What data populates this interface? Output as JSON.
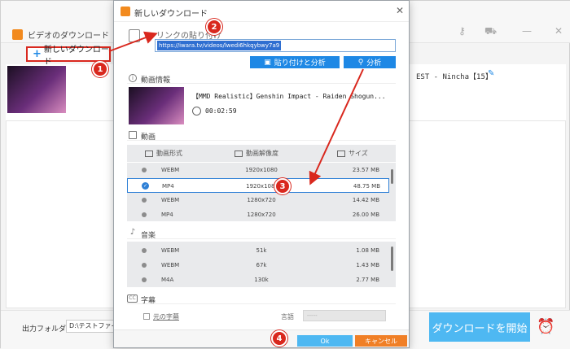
{
  "app": {
    "title": "ビデオのダウンロード",
    "new_download_label": "新しいダウンロード",
    "item_title": "EST - Nincha【15】",
    "output_folder_label": "出力フォルダ：",
    "output_folder_value": "D:\\テストファイル",
    "start_download_label": "ダウンロードを開始"
  },
  "dialog": {
    "title": "新しいダウンロード",
    "paste_link_label": "リンクの貼り付け",
    "url_value": "https://iwara.tv/videos/lwedi6hkqybwy7a9",
    "paste_analyze_label": "貼り付けと分析",
    "analyze_label": "分析",
    "video_info_label": "動画情報",
    "video_title": "【MMD Realistic】Genshin Impact - Raiden Shogun...",
    "duration": "00:02:59",
    "video_section_label": "動画",
    "video_headers": [
      "動画形式",
      "動画解像度",
      "サイズ"
    ],
    "video_rows": [
      {
        "format": "WEBM",
        "res": "1920x1080",
        "size": "23.57 MB",
        "selected": false
      },
      {
        "format": "MP4",
        "res": "1920x1080",
        "size": "48.75 MB",
        "selected": true
      },
      {
        "format": "WEBM",
        "res": "1280x720",
        "size": "14.42 MB",
        "selected": false
      },
      {
        "format": "MP4",
        "res": "1280x720",
        "size": "26.00 MB",
        "selected": false
      }
    ],
    "audio_section_label": "音楽",
    "audio_rows": [
      {
        "format": "WEBM",
        "bitrate": "51k",
        "size": "1.08 MB"
      },
      {
        "format": "WEBM",
        "bitrate": "67k",
        "size": "1.43 MB"
      },
      {
        "format": "M4A",
        "bitrate": "130k",
        "size": "2.77 MB"
      }
    ],
    "subtitle_section_label": "字幕",
    "subtitle_original_label": "元の字幕",
    "language_label": "言語",
    "language_value": "-----",
    "ok_label": "Ok",
    "cancel_label": "キャンセル"
  },
  "annotations": [
    "1",
    "2",
    "3",
    "4"
  ],
  "colors": {
    "accent_blue": "#1e88e5",
    "start_blue": "#4eb8f2",
    "cancel_orange": "#f07f26",
    "annotation_red": "#d9281e"
  }
}
